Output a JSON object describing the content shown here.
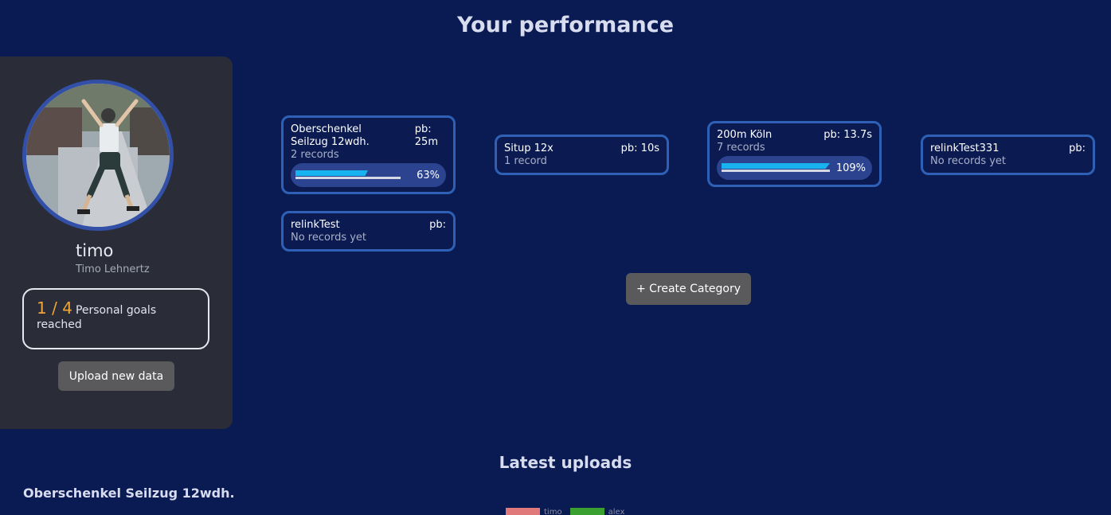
{
  "page": {
    "title": "Your performance"
  },
  "profile": {
    "username": "timo",
    "full_name": "Timo Lehnertz",
    "goals_reached": "1",
    "goals_separator": "/",
    "goals_total": "4",
    "goals_label": "Personal goals reached",
    "upload_button": "Upload new data"
  },
  "categories": [
    {
      "name": "Oberschenkel Seilzug 12wdh.",
      "pb": "pb:\n25m",
      "records": "2 records",
      "progress": 0.63,
      "progress_label": "63%"
    },
    {
      "name": "Situp 12x",
      "pb": "pb: 10s",
      "records": "1 record"
    },
    {
      "name": "200m Köln",
      "pb": "pb: 13.7s",
      "records": "7 records",
      "progress": 1.09,
      "progress_label": "109%"
    },
    {
      "name": "relinkTest331",
      "pb": "pb:",
      "records": "No records yet"
    },
    {
      "name": "relinkTest",
      "pb": "pb:",
      "records": "No records yet"
    }
  ],
  "create_category_button": "+ Create Category",
  "latest": {
    "title": "Latest uploads",
    "category": "Oberschenkel Seilzug 12wdh.",
    "legend": [
      {
        "name": "timo",
        "color": "#e07a7a"
      },
      {
        "name": "alex",
        "color": "#3aa02f"
      }
    ]
  },
  "colors": {
    "background": "#0a1a52",
    "card_border": "#2e61b6",
    "accent_goal": "#f0a43a",
    "progress": "#18b3ef"
  }
}
